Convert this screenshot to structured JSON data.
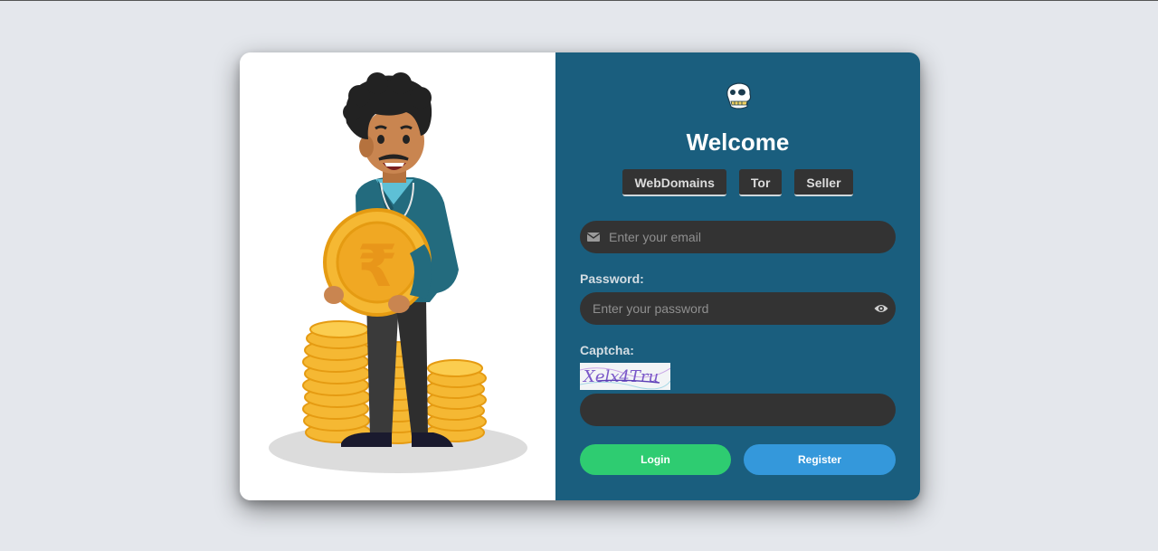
{
  "illustration": {
    "description_icon": "man-holding-rupee-coin-illustration",
    "coin_symbol": "₹"
  },
  "header": {
    "logo_icon": "ape-skull-logo-icon",
    "title": "Welcome"
  },
  "tabs": [
    {
      "label": "WebDomains"
    },
    {
      "label": "Tor"
    },
    {
      "label": "Seller"
    }
  ],
  "email": {
    "icon": "envelope-icon",
    "placeholder": "Enter your email",
    "value": ""
  },
  "password": {
    "label": "Password:",
    "placeholder": "Enter your password",
    "value": "",
    "toggle_icon": "eye-icon"
  },
  "captcha": {
    "label": "Captcha:",
    "image_text": "Xelx4Tru",
    "placeholder": "",
    "value": ""
  },
  "actions": {
    "login_label": "Login",
    "register_label": "Register"
  },
  "colors": {
    "page_bg": "#e4e7ec",
    "panel_bg": "#1a5e7e",
    "field_bg": "#333333",
    "login": "#2ecc71",
    "register": "#3498db",
    "coin": "#f5b833"
  }
}
